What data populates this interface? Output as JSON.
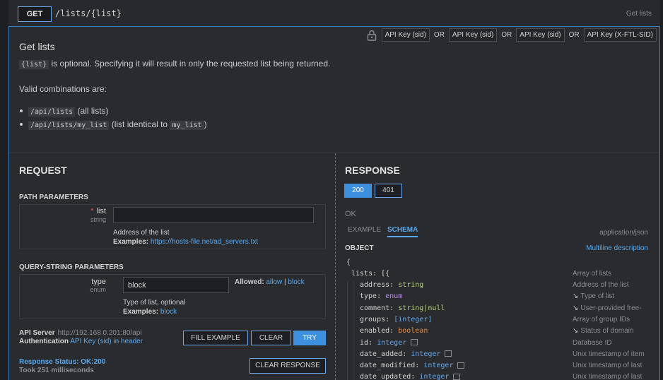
{
  "header": {
    "method": "GET",
    "path": "/lists/{list}",
    "tag": "Get lists"
  },
  "auth": {
    "items": [
      "API Key (sid)",
      "API Key (sid)",
      "API Key (sid)",
      "API Key (X-FTL-SID)"
    ],
    "or": "OR"
  },
  "summary": "Get lists",
  "description": {
    "code1": "{list}",
    "text1": " is optional. Specifying it will result in only the requested list being returned.",
    "text2": "Valid combinations are:",
    "bullet1_code": "/api/lists",
    "bullet1_text": " (all lists)",
    "bullet2_code": "/api/lists/my_list",
    "bullet2_text": " (list identical to ",
    "bullet2_code2": "my_list",
    "bullet2_end": ")"
  },
  "request": {
    "title": "REQUEST",
    "path_params_title": "PATH PARAMETERS",
    "path_param": {
      "name": "list",
      "type": "string",
      "value": "",
      "description": "Address of the list",
      "examples_label": "Examples:",
      "example": "https://hosts-file.net/ad_servers.txt"
    },
    "query_params_title": "QUERY-STRING PARAMETERS",
    "query_param": {
      "name": "type",
      "type": "enum",
      "value": "block",
      "allowed_label": "Allowed:",
      "allowed": [
        "allow",
        "block"
      ],
      "sep": "|",
      "description": "Type of list, optional",
      "examples_label": "Examples:",
      "example": "block"
    },
    "api_server_label": "API Server",
    "api_server": "http://192.168.0.201:80/api",
    "auth_label": "Authentication",
    "auth_value": "API Key (sid) in header",
    "buttons": {
      "fill": "FILL EXAMPLE",
      "clear": "CLEAR",
      "try": "TRY",
      "clear_response": "CLEAR RESPONSE"
    },
    "status": "Response Status: OK:200",
    "took": "Took 251 milliseconds"
  },
  "response": {
    "title": "RESPONSE",
    "codes": [
      "200",
      "401"
    ],
    "status_text": "OK",
    "tabs": [
      "EXAMPLE",
      "SCHEMA"
    ],
    "mime": "application/json",
    "object_label": "OBJECT",
    "multiline": "Multiline description",
    "open_brace": "{",
    "root": {
      "key": "lists: [{",
      "desc": "Array of lists"
    },
    "fields": [
      {
        "key": "address:",
        "type": "string",
        "color": "green",
        "desc": "Address of the list",
        "arrow": false,
        "box": false
      },
      {
        "key": "type:",
        "type": "enum",
        "color": "purple",
        "desc": "Type of list",
        "arrow": true,
        "box": false
      },
      {
        "key": "comment:",
        "type": "string|null",
        "color": "green",
        "desc": "User-provided free-",
        "arrow": true,
        "box": false
      },
      {
        "key": "groups:",
        "type": "[integer]",
        "color": "blue",
        "desc": "Array of group IDs",
        "arrow": false,
        "box": false
      },
      {
        "key": "enabled:",
        "type": "boolean",
        "color": "orange",
        "desc": "Status of domain",
        "arrow": true,
        "box": false
      },
      {
        "key": "id:",
        "type": "integer",
        "color": "blue",
        "desc": "Database ID",
        "arrow": false,
        "box": true
      },
      {
        "key": "date_added:",
        "type": "integer",
        "color": "blue",
        "desc": "Unix timestamp of item",
        "arrow": false,
        "box": true
      },
      {
        "key": "date_modified:",
        "type": "integer",
        "color": "blue",
        "desc": "Unix timestamp of last",
        "arrow": false,
        "box": true
      },
      {
        "key": "date_updated:",
        "type": "integer",
        "color": "blue",
        "desc": "Unix timestamp of last",
        "arrow": false,
        "box": true
      }
    ]
  },
  "colors": {
    "accent": "#3d8fe0",
    "link": "#5aa9ef",
    "background": "#292b2e",
    "header": "#27292c"
  }
}
